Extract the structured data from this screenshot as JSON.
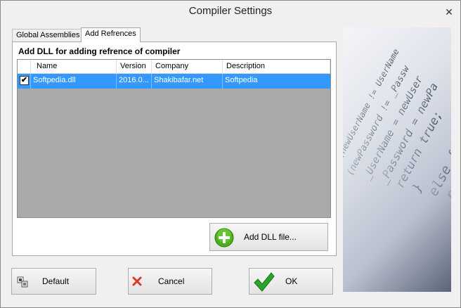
{
  "window": {
    "title": "Compiler Settings",
    "close_glyph": "✕"
  },
  "tabs": [
    {
      "label": "Global Assemblies",
      "active": false
    },
    {
      "label": "Add Refrences",
      "active": true
    }
  ],
  "panel": {
    "heading": "Add DLL for adding refrence of compiler",
    "columns": [
      "Name",
      "Version",
      "Company",
      "Description"
    ],
    "rows": [
      {
        "checked": true,
        "name": "Softpedia.dll",
        "version": "2016.0...",
        "company": "Shakibafar.net",
        "description": "Softpedia"
      }
    ],
    "add_button": "Add DLL file...",
    "check_glyph": "✔"
  },
  "footer": {
    "default_button": "Default",
    "cancel_button": "Cancel",
    "ok_button": "OK"
  },
  "side_image": {
    "code_lines": [
      "if((newUserName != UserName",
      "  (newPassword != _Passw",
      "  _UserName = newUser",
      "  _Password = newPa",
      "  return true;",
      "}",
      "else {",
      "  return fa"
    ]
  },
  "colors": {
    "selection": "#3399ff",
    "grid_bg": "#aaaaaa",
    "ok_green": "#2aa52a",
    "cancel_red": "#d93a2b",
    "plus_green": "#4caf1a"
  }
}
